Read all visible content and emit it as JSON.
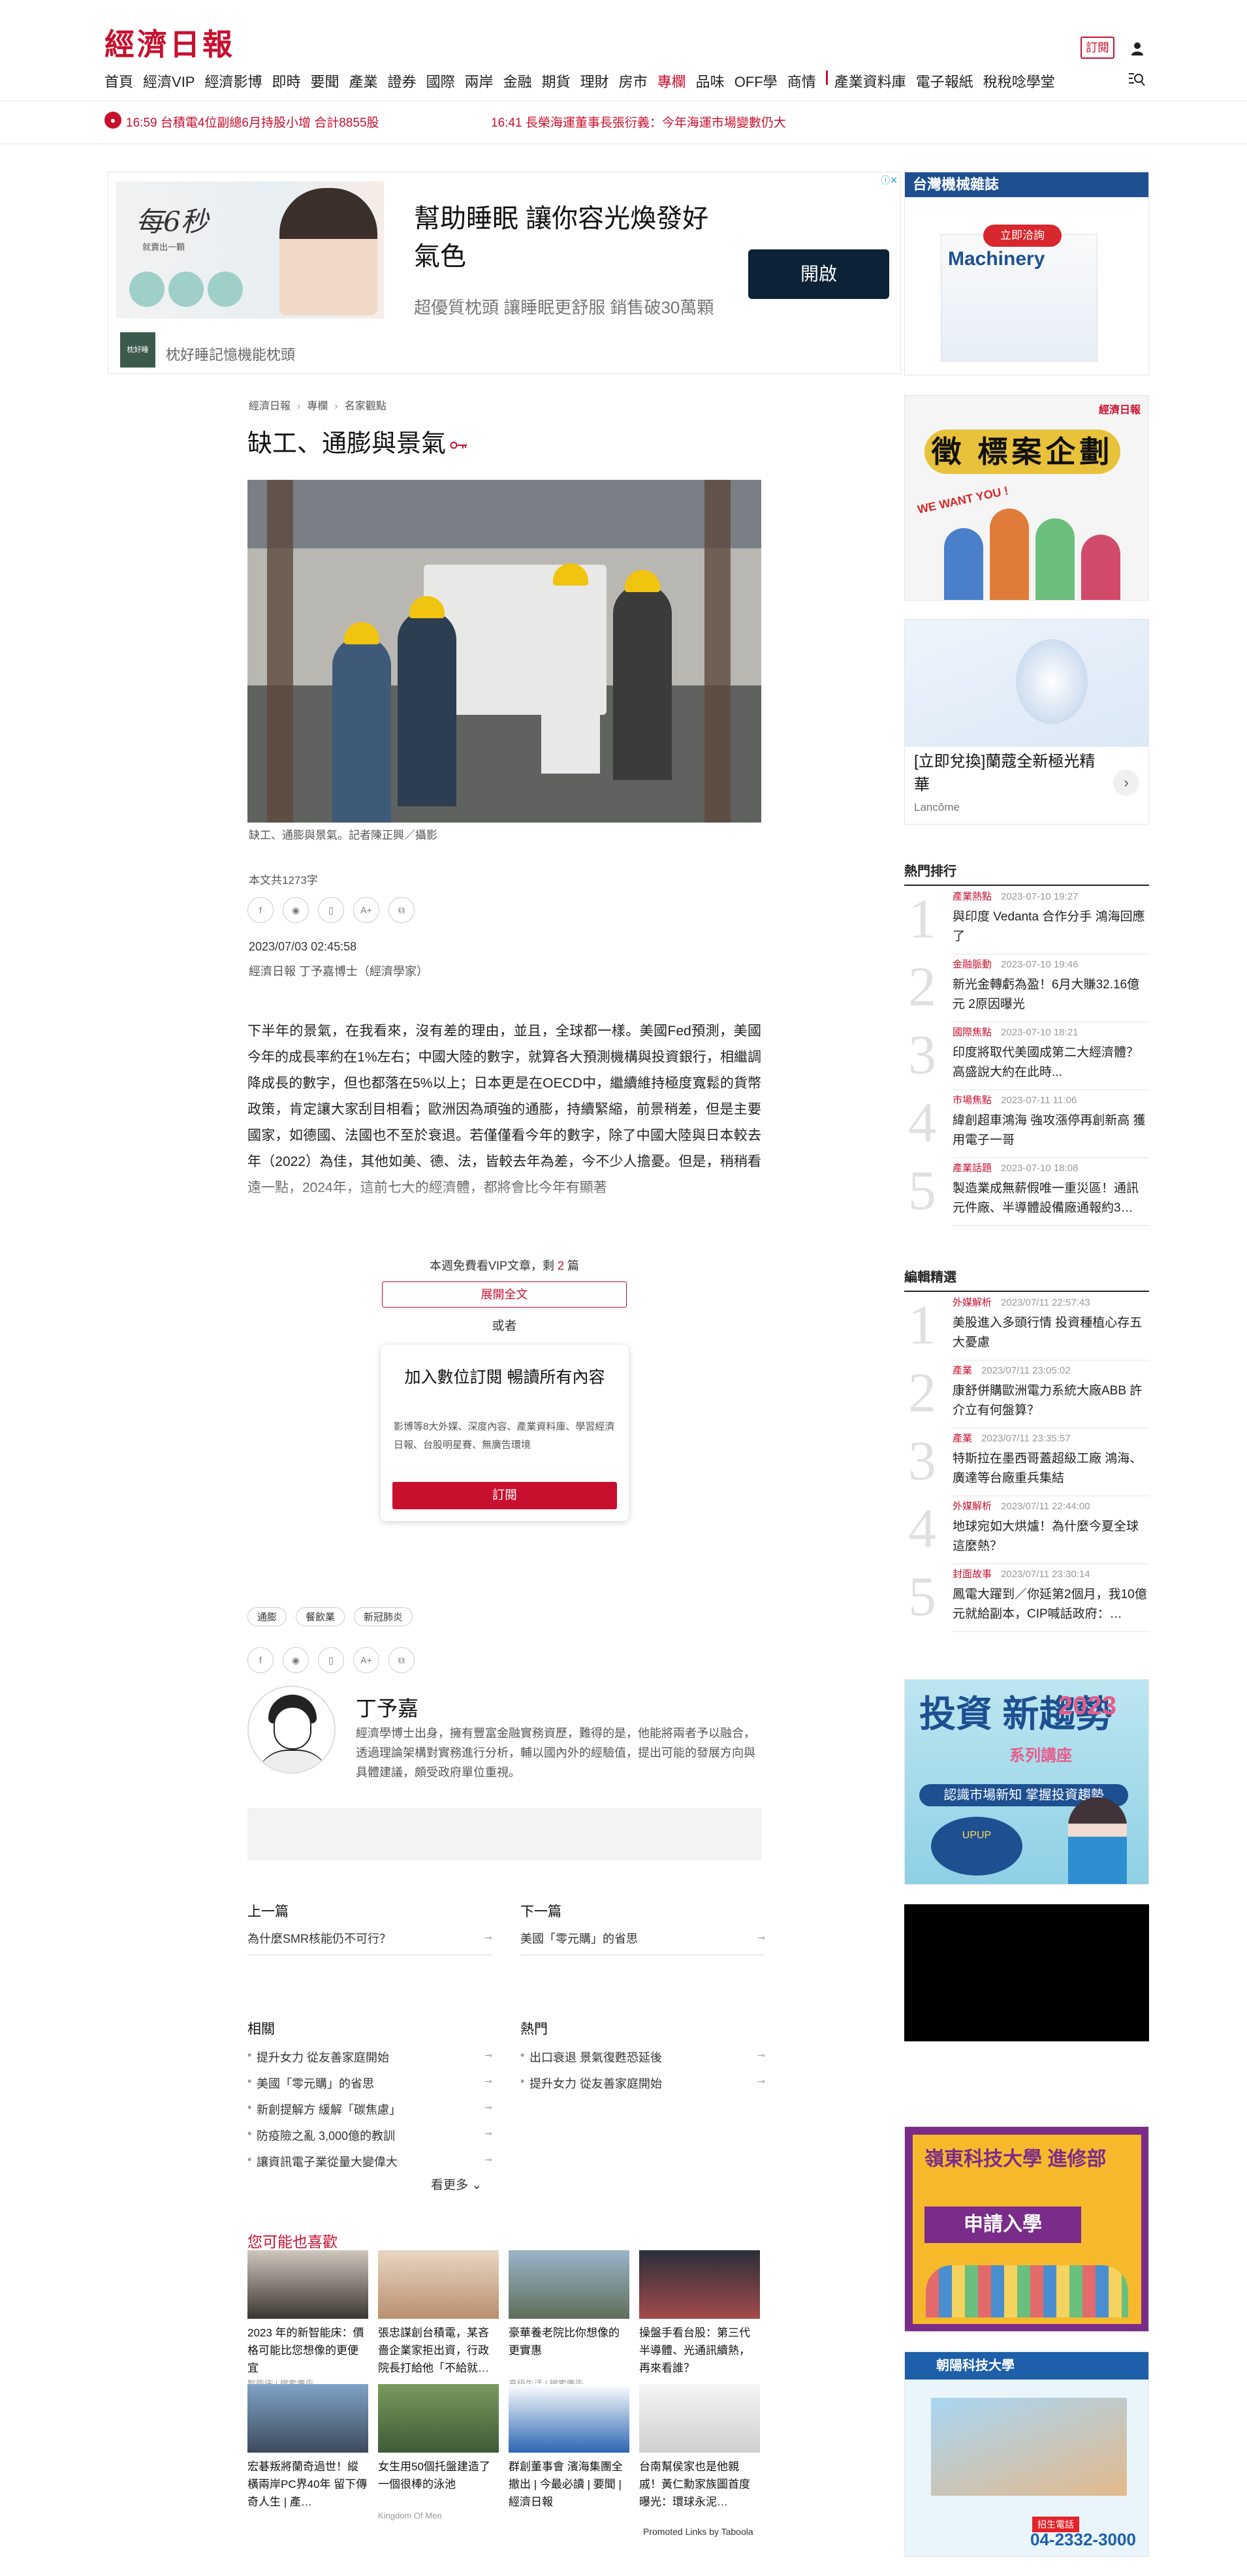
{
  "header": {
    "logo": "經濟日報",
    "subscribe": "訂閱",
    "nav": [
      "首頁",
      "經濟VIP",
      "經濟影博",
      "即時",
      "要聞",
      "產業",
      "證券",
      "國際",
      "兩岸",
      "金融",
      "期貨",
      "理財",
      "房市",
      "專欄",
      "品味",
      "OFF學",
      "商情"
    ],
    "nav_active": "專欄",
    "nav_extra": [
      "產業資料庫",
      "電子報紙",
      "稅稅唸學堂"
    ]
  },
  "ticker": [
    "16:59 台積電4位副總6月持股小增 合計8855股",
    "16:41 長榮海運董事長張衍義：今年海運市場變數仍大"
  ],
  "top_ad": {
    "headline": "幫助睡眠 讓你容光煥發好氣色",
    "desc": "超優質枕頭 讓睡眠更舒服 銷售破30萬顆",
    "button": "開啟",
    "brand": "枕好睡記憶機能枕頭",
    "img_big": "每6秒",
    "img_small": "就賣出一顆"
  },
  "breadcrumb": [
    "經濟日報",
    "專欄",
    "名家觀點"
  ],
  "article": {
    "title": "缺工、通膨與景氣",
    "caption": "缺工、通膨與景氣。記者陳正興／攝影",
    "wordcount": "本文共1273字",
    "pubtime": "2023/07/03 02:45:58",
    "byline": "經濟日報 丁予嘉博士（經濟學家）",
    "body": "下半年的景氣，在我看來，沒有差的理由，並且，全球都一樣。美國Fed預測，美國今年的成長率約在1%左右；中國大陸的數字，就算各大預測機構與投資銀行，相繼調降成長的數字，但也都落在5%以上；日本更是在OECD中，繼續維持極度寬鬆的貨幣政策，肯定讓大家刮目相看；歐洲因為頑強的通膨，持續緊縮，前景稍差，但是主要國家，如德國、法國也不至於衰退。若僅僅看今年的數字，除了中國大陸與日本較去年（2022）為佳，其他如美、德、法，皆較去年為差，今不少人擔憂。但是，稍稍看遠一點，2024年，這前七大的經濟體，都將會比今年有顯著"
  },
  "paywall": {
    "vip_prefix": "本週免費看VIP文章，剩",
    "vip_count": "2",
    "vip_suffix": "篇",
    "expand": "展開全文",
    "or": "或者",
    "card_title": "加入數位訂閱 暢讀所有內容",
    "card_desc": "影博等8大外媒、深度內容、產業資料庫、學習經濟日報、台股明星賽、無廣告環境",
    "card_button": "訂閱"
  },
  "tags": [
    "通膨",
    "餐飲業",
    "新冠肺炎"
  ],
  "author": {
    "name": "丁予嘉",
    "bio": "經濟學博士出身，擁有豐富金融實務資歷，難得的是，他能將兩者予以融合，透過理論架構對實務進行分析，輔以國內外的經驗值，提出可能的發展方向與具體建議，頗受政府單位重視。"
  },
  "prev": {
    "label": "上一篇",
    "title": "為什麼SMR核能仍不可行？"
  },
  "next": {
    "label": "下一篇",
    "title": "美國「零元購」的省思"
  },
  "related": {
    "label": "相關",
    "items": [
      "提升女力 從友善家庭開始",
      "美國「零元購」的省思",
      "新創提解方 緩解「碳焦慮」",
      "防疫險之亂 3,000億的教訓",
      "讓資訊電子業從量大變偉大"
    ]
  },
  "hot": {
    "label": "熱門",
    "items": [
      "出口衰退 景氣復甦恐延後",
      "提升女力 從友善家庭開始"
    ]
  },
  "more": "看更多",
  "recommend": {
    "title": "您可能也喜歡",
    "cards": [
      {
        "title": "2023 年的新智能床：價格可能比您想像的更便宜",
        "source": "智能床 | 搜索廣告"
      },
      {
        "title": "張忠謀創台積電，某吝嗇企業家拒出資，行政院長打給他「不給就…",
        "source": ""
      },
      {
        "title": "豪華養老院比你想像的更實惠",
        "source": "高級生活 | 搜索廣告"
      },
      {
        "title": "操盤手看台股：第三代半導體、光通訊續熱，再來看誰？",
        "source": ""
      },
      {
        "title": "宏碁叛將蘭奇過世！縱橫兩岸PC界40年 留下傳奇人生 | 產…",
        "source": ""
      },
      {
        "title": "女生用50個托盤建造了一個很棒的泳池",
        "source": "Kingdom Of Men"
      },
      {
        "title": "群創董事會 濱海集團全撤出 | 今最必讀 | 要聞 | 經濟日報",
        "source": ""
      },
      {
        "title": "台南幫侯家也是他親戚！黃仁勳家族圖首度曝光：環球永泥…",
        "source": ""
      }
    ],
    "promo": "Promoted Links by Taboola"
  },
  "sidebar": {
    "machinery_title": "台灣機械雜誌",
    "machinery_btn": "立即洽詢",
    "machinery_cover": "Machinery",
    "tender_brand": "經濟日報",
    "tender_title": "徵 標案企劃",
    "tender_want": "WE WANT YOU !",
    "lancome_title": "[立即兌換]蘭蔻全新極光精華",
    "lancome_brand": "Lancôme",
    "hot_title": "熱門排行",
    "hot_items": [
      {
        "cat": "產業熱點",
        "time": "2023-07-10 19:27",
        "title": "與印度 Vedanta 合作分手 鴻海回應了"
      },
      {
        "cat": "金融脈動",
        "time": "2023-07-10 19:46",
        "title": "新光金轉虧為盈！6月大賺32.16億元 2原因曝光"
      },
      {
        "cat": "國際焦點",
        "time": "2023-07-10 18:21",
        "title": "印度將取代美國成第二大經濟體？高盛說大約在此時..."
      },
      {
        "cat": "市場焦點",
        "time": "2023-07-11 11:06",
        "title": "緯創超車鴻海 強攻漲停再創新高 獲用電子一哥"
      },
      {
        "cat": "產業話題",
        "time": "2023-07-10 18:08",
        "title": "製造業成無薪假唯一重災區！通訊元件廠、半導體設備廠通報約3…"
      }
    ],
    "editor_title": "編輯精選",
    "editor_items": [
      {
        "cat": "外媒解析",
        "time": "2023/07/11 22:57:43",
        "title": "美股進入多頭行情 投資種植心存五大憂慮"
      },
      {
        "cat": "產業",
        "time": "2023/07/11 23:05:02",
        "title": "康舒併購歐洲電力系統大廠ABB 許介立有何盤算？"
      },
      {
        "cat": "產業",
        "time": "2023/07/11 23:35:57",
        "title": "特斯拉在墨西哥蓋超級工廠 鴻海、廣達等台廠重兵集結"
      },
      {
        "cat": "外媒解析",
        "time": "2023/07/11 22:44:00",
        "title": "地球宛如大烘爐！為什麼今夏全球這麼熱？"
      },
      {
        "cat": "封面故事",
        "time": "2023/07/11 23:30:14",
        "title": "鳳電大躍到／你延第2個月，我10億元就給副本，CIP喊話政府：…"
      }
    ],
    "invest_title": "投資 新趨勢",
    "invest_sub": "系列講座",
    "invest_year": "2023",
    "invest_line": "認識市場新知 掌握投資趨勢",
    "college_title": "嶺東科技大學 進修部",
    "college_sub": "申請入學",
    "tech_title": "朝陽科技大學",
    "tech_phone_label": "招生電話",
    "tech_phone": "04-2332-3000"
  },
  "colors": {
    "brand_red": "#c8102e",
    "ad_navy": "#0c2236"
  }
}
